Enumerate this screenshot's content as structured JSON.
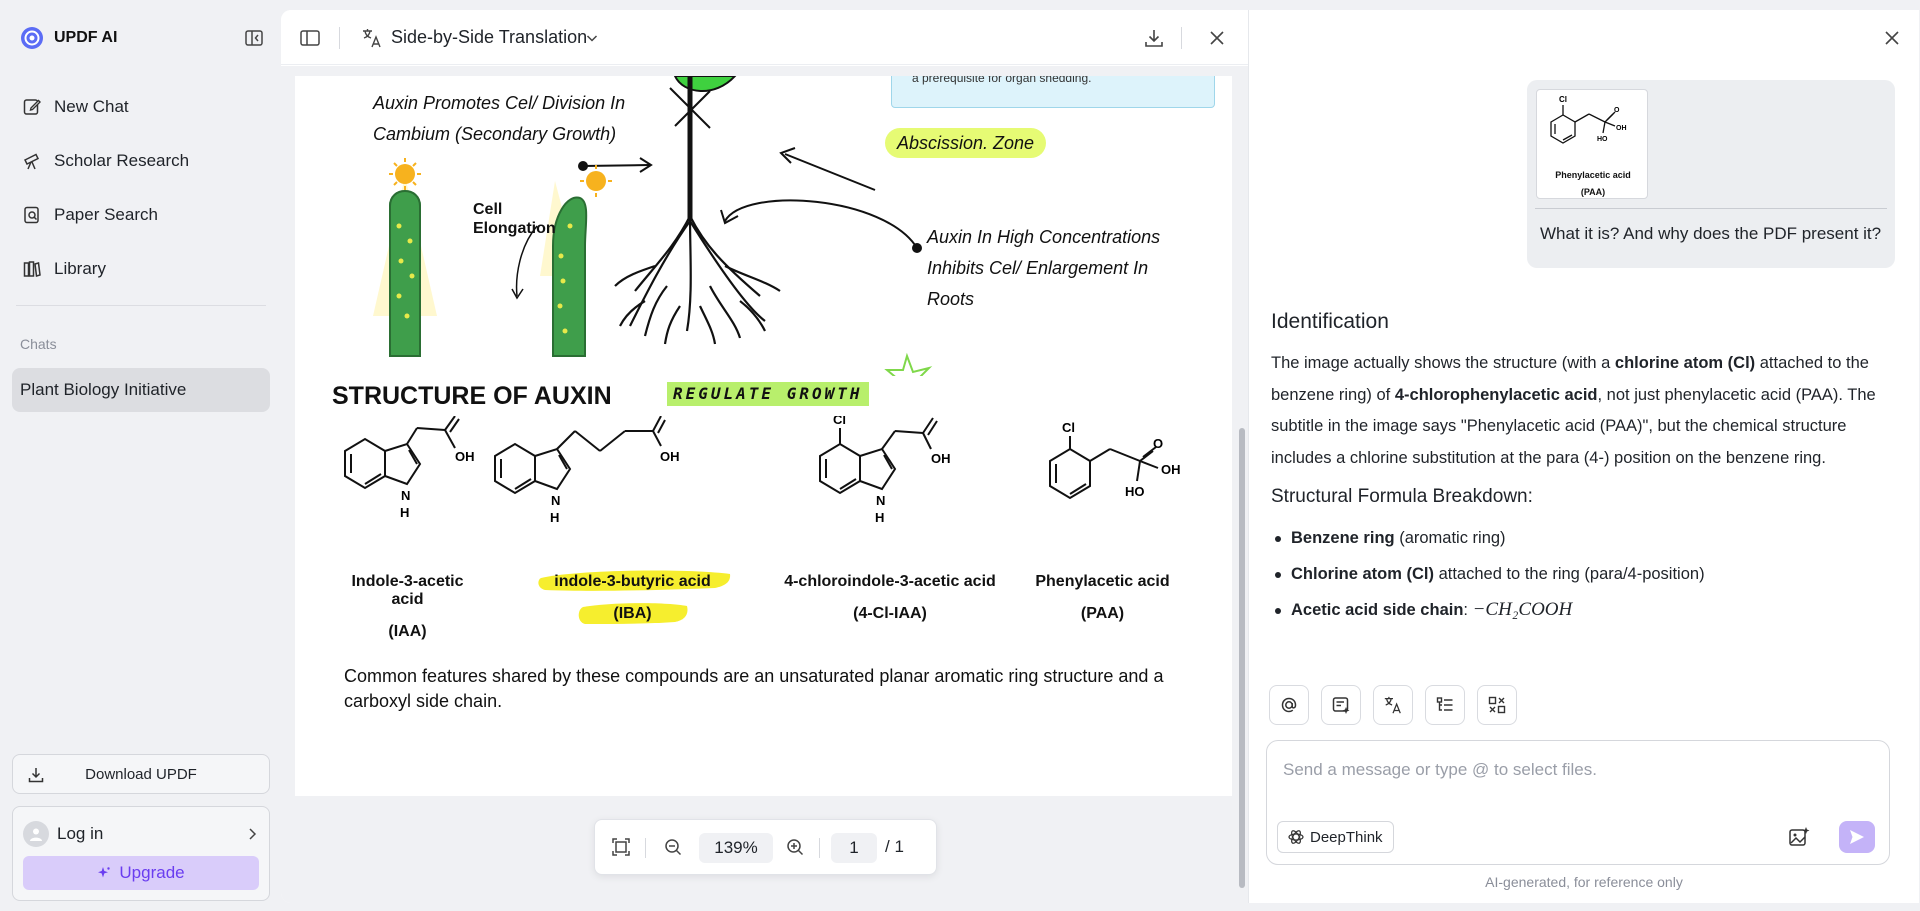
{
  "app": {
    "name": "UPDF AI"
  },
  "sidebar": {
    "nav": [
      {
        "label": "New Chat",
        "icon": "edit-icon"
      },
      {
        "label": "Scholar Research",
        "icon": "telescope-icon"
      },
      {
        "label": "Paper Search",
        "icon": "doc-search-icon"
      },
      {
        "label": "Library",
        "icon": "library-icon"
      }
    ],
    "chats_label": "Chats",
    "chats": [
      {
        "label": "Plant Biology Initiative"
      }
    ],
    "download_label": "Download UPDF",
    "login_label": "Log in",
    "upgrade_label": "Upgrade"
  },
  "viewer": {
    "mode": "Side-by-Side Translation",
    "zoom": "139%",
    "page_current": "1",
    "page_total": "/ 1",
    "page": {
      "box_text": "a prerequisite for organ shedding.",
      "cambium_line1": "Auxin Promotes Cel/ Division In",
      "cambium_line2": "Cambium (Secondary Growth)",
      "abscission": "Abscission. Zone",
      "cell_elongation_1": "Cell",
      "cell_elongation_2": "Elongation",
      "roots_line1": "Auxin In High Concentrations",
      "roots_line2": "Inhibits Cel/ Enlargement In",
      "roots_line3": "Roots",
      "structure_title": "STRUCTURE OF AUXIN",
      "regulate": "REGULATE GROWTH",
      "compounds": [
        {
          "name": "Indole-3-acetic acid",
          "abbr": "(IAA)"
        },
        {
          "name": "indole-3-butyric acid",
          "abbr": "(IBA)"
        },
        {
          "name": "4-chloroindole-3-acetic acid",
          "abbr": "(4-Cl-IAA)"
        },
        {
          "name": "Phenylacetic acid",
          "abbr": "(PAA)"
        }
      ],
      "atoms": {
        "oh": "OH",
        "ho": "HO",
        "n": "N",
        "h": "H",
        "cl": "Cl",
        "o": "O"
      },
      "common_text": "Common features shared by these compounds are an unsaturated planar aromatic ring structure and a carboxyl side chain."
    }
  },
  "chat": {
    "thumbnail_label_1": "Phenylacetic acid",
    "thumbnail_label_2": "(PAA)",
    "user_question": "What it is? And why does the PDF present it?",
    "answer": {
      "heading": "Identification",
      "p1_a": "The image actually shows the structure (with a ",
      "p1_b": "chlorine atom (Cl)",
      "p1_c": " attached to the benzene ring) of ",
      "p1_d": "4-chlorophenylacetic acid",
      "p1_e": ", not just phenylacetic acid (PAA). The subtitle in the image says \"Phenylacetic acid (PAA)\", but the chemical structure includes a chlorine substitution at the para (4-) position on the benzene ring.",
      "subheading": "Structural Formula Breakdown:",
      "bullets": [
        {
          "bold": "Benzene ring",
          "rest": " (aromatic ring)"
        },
        {
          "bold": "Chlorine atom (Cl)",
          "rest": " attached to the ring (para/4-position)"
        },
        {
          "bold": "Acetic acid side chain",
          "rest": ":"
        }
      ],
      "formula": "−CH₂COOH"
    },
    "input_placeholder": "Send a message or type @ to select files.",
    "deepthink_label": "DeepThink",
    "disclaimer": "AI-generated, for reference only"
  },
  "colors": {
    "accent": "#6a3df0",
    "highlight_green": "#e6fb74",
    "highlight_yellow": "#f6ee2e"
  }
}
